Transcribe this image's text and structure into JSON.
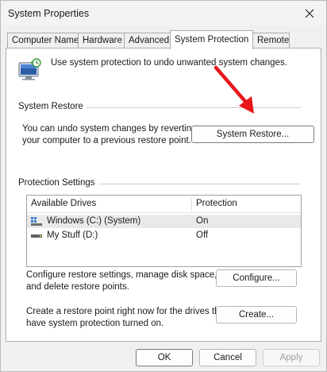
{
  "window": {
    "title": "System Properties"
  },
  "tabs": [
    {
      "label": "Computer Name"
    },
    {
      "label": "Hardware"
    },
    {
      "label": "Advanced"
    },
    {
      "label": "System Protection",
      "active": true
    },
    {
      "label": "Remote"
    }
  ],
  "intro_text": "Use system protection to undo unwanted system changes.",
  "system_restore": {
    "group_label": "System Restore",
    "description": "You can undo system changes by reverting\nyour computer to a previous restore point.",
    "button_label": "System Restore..."
  },
  "protection_settings": {
    "group_label": "Protection Settings",
    "columns": [
      "Available Drives",
      "Protection"
    ],
    "drives": [
      {
        "name": "Windows (C:) (System)",
        "protection": "On",
        "icon": "system-drive-icon"
      },
      {
        "name": "My Stuff (D:)",
        "protection": "Off",
        "icon": "drive-icon"
      }
    ],
    "configure_text": "Configure restore settings, manage disk space,\nand delete restore points.",
    "configure_button": "Configure...",
    "create_text": "Create a restore point right now for the drives that\nhave system protection turned on.",
    "create_button": "Create..."
  },
  "footer": {
    "ok": "OK",
    "cancel": "Cancel",
    "apply": "Apply"
  },
  "colors": {
    "annotation_arrow": "#e8171b",
    "window_bg": "#f0f0f0"
  }
}
